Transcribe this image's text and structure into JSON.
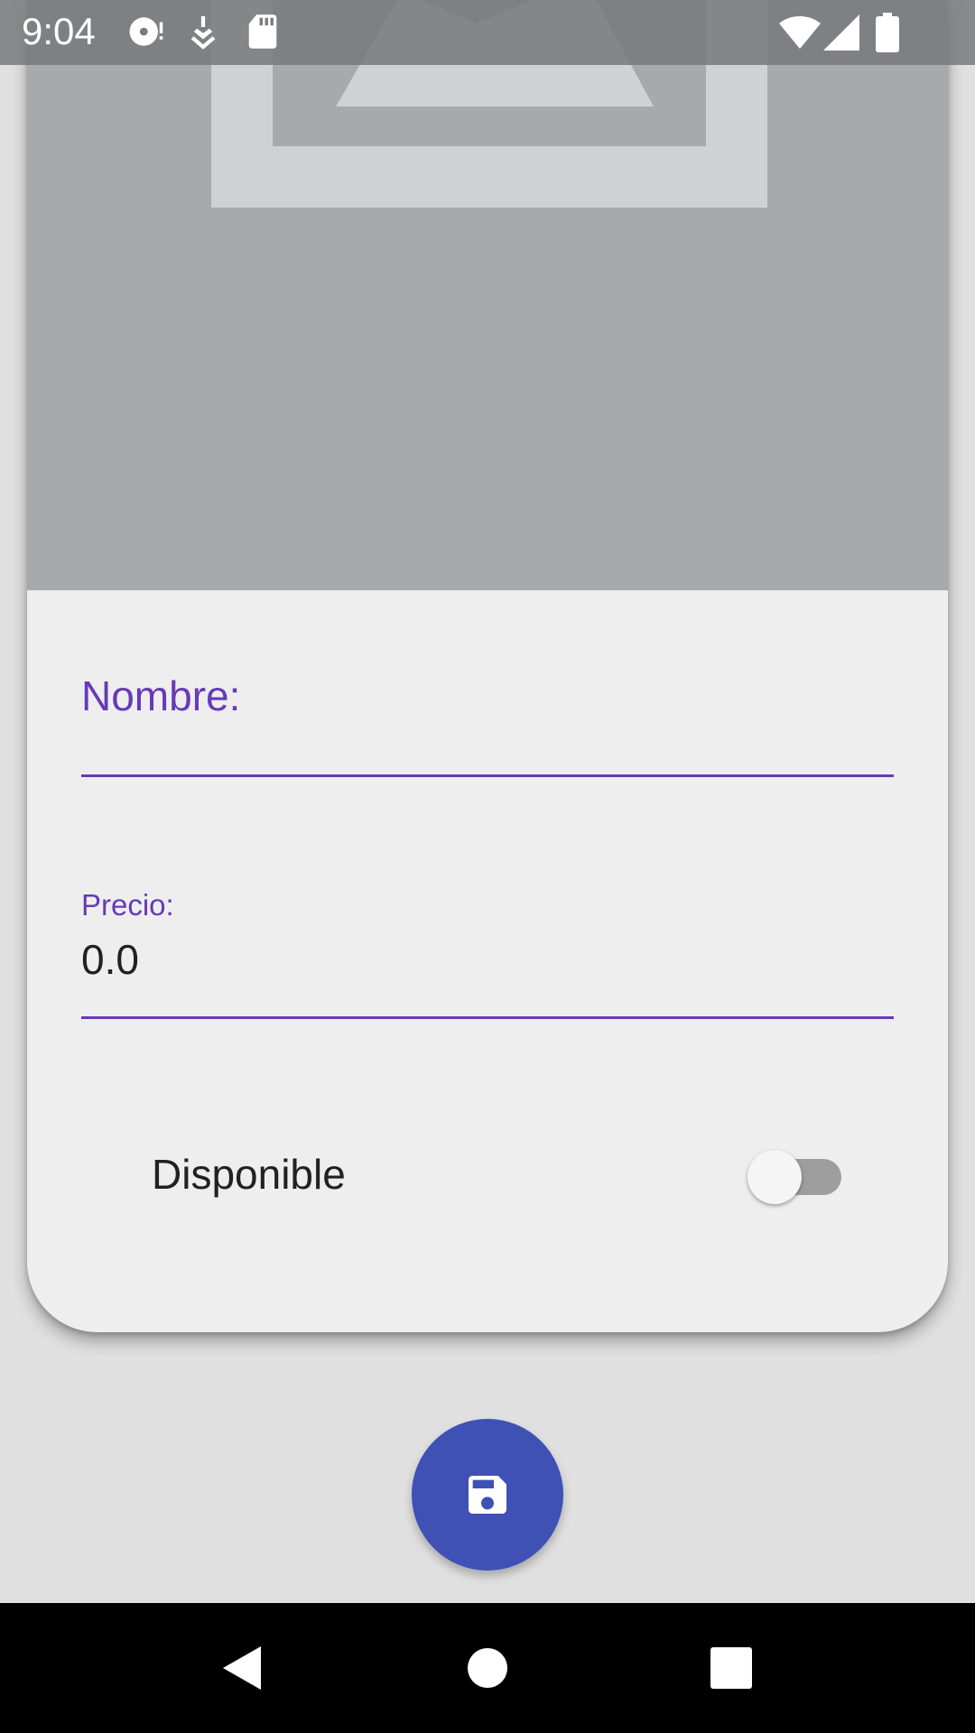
{
  "status_bar": {
    "time": "9:04",
    "left_icons": [
      "disc-icon",
      "download-icon",
      "sd-card-icon"
    ],
    "right_icons": [
      "wifi-icon",
      "signal-icon",
      "battery-icon"
    ]
  },
  "image": {
    "icon": "image-placeholder-icon"
  },
  "form": {
    "nombre": {
      "label": "Nombre:",
      "value": ""
    },
    "precio": {
      "label": "Precio:",
      "value": "0.0"
    },
    "disponible": {
      "label": "Disponible",
      "checked": false
    }
  },
  "fab": {
    "icon": "save-icon"
  },
  "nav_bar": {
    "icons": [
      "back-icon",
      "home-icon",
      "recents-icon"
    ]
  },
  "colors": {
    "accent": "#673ab7",
    "fab": "#3f51b5",
    "card": "#eeeeee",
    "background": "#e0e0e0",
    "image_placeholder": "#a8a9ab"
  }
}
